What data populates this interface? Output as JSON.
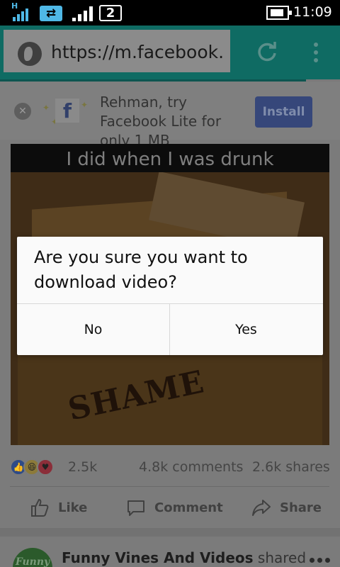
{
  "status_bar": {
    "network_indicator": "H",
    "sim_slot": "2",
    "time": "11:09",
    "icons": [
      "signal-icon",
      "data-sync-icon",
      "signal-icon",
      "sim-icon",
      "battery-charging-icon"
    ]
  },
  "browser": {
    "url": "https://m.facebook.",
    "icons": [
      "globe-icon",
      "reload-icon",
      "overflow-menu-icon"
    ]
  },
  "banner": {
    "message": "Rehman, try Facebook Lite for only 1 MB",
    "install_label": "Install",
    "logo_letter": "f"
  },
  "video": {
    "caption": "I did when I was drunk",
    "overlay_word": "SHAME"
  },
  "post_stats": {
    "reactions": "2.5k",
    "comments": "4.8k comments",
    "shares": "2.6k shares"
  },
  "post_actions": {
    "like": "Like",
    "comment": "Comment",
    "share": "Share"
  },
  "next_post": {
    "page_name": "Funny Vines And Videos",
    "action": "shared",
    "avatar_text": "Funny"
  },
  "dialog": {
    "message": "Are you sure you want to download video?",
    "no_label": "No",
    "yes_label": "Yes"
  },
  "colors": {
    "toolbar": "#0f6b63",
    "install_button": "#36477a",
    "dialog_bg": "#fafafa",
    "dim_overlay": "#7b7b7b"
  }
}
